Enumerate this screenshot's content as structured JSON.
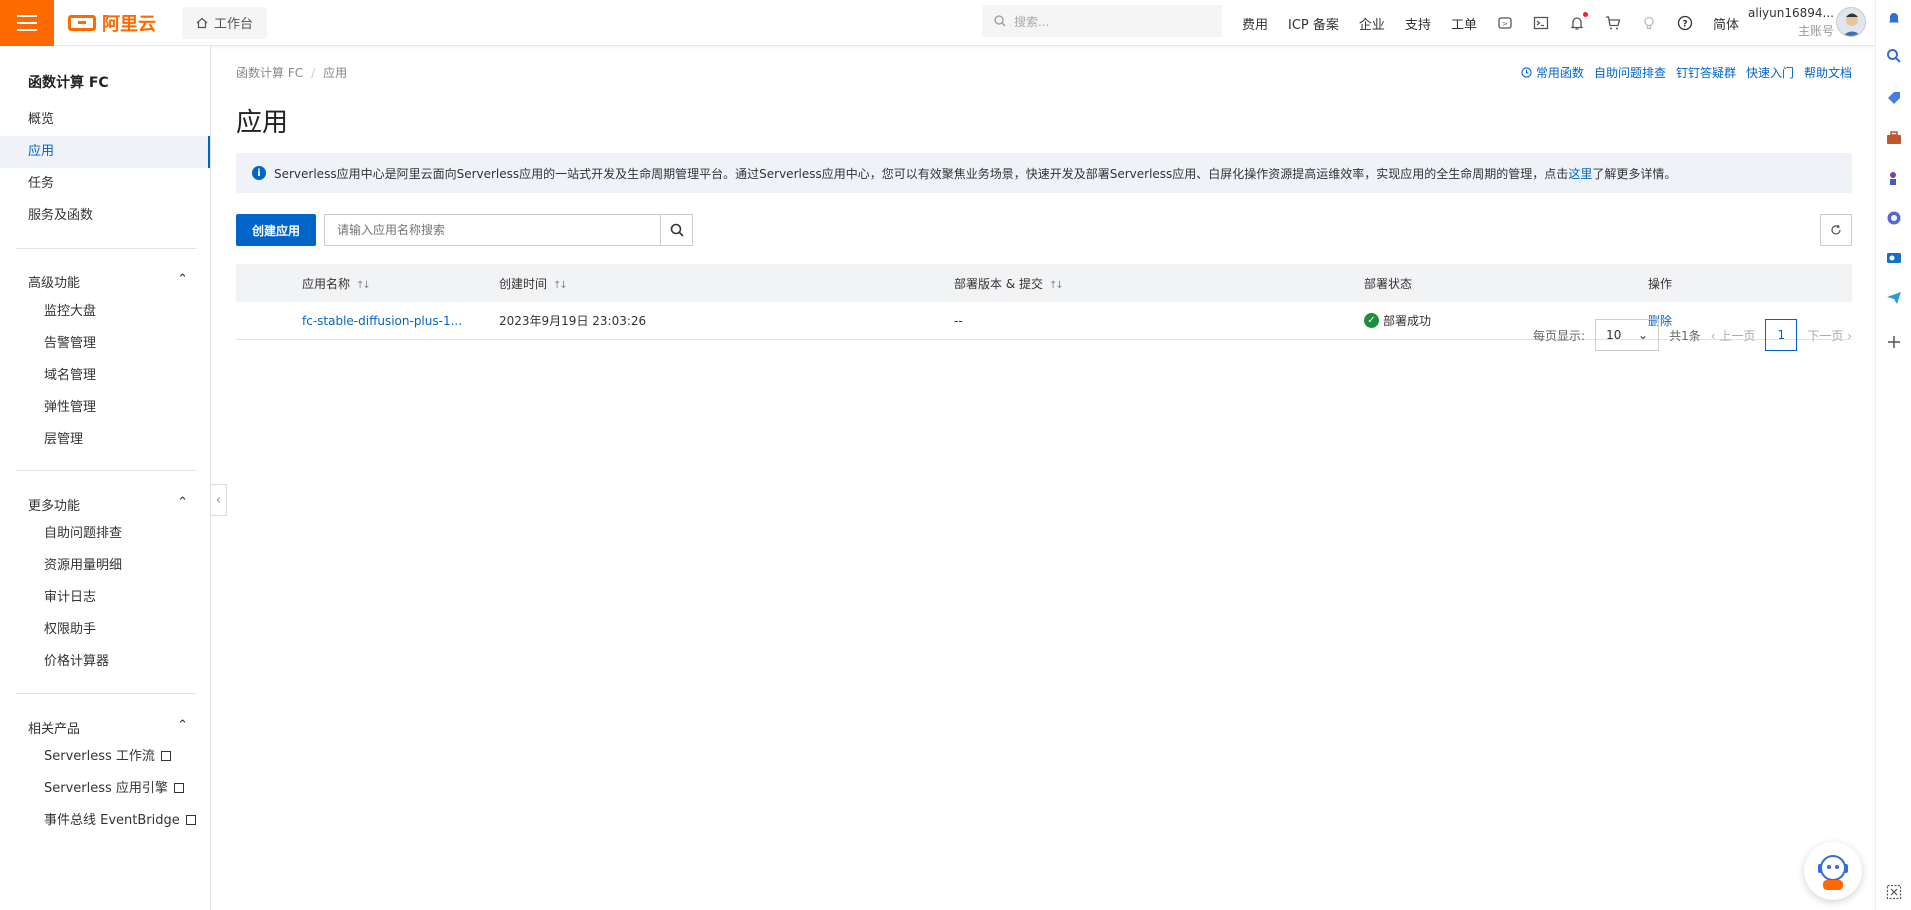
{
  "topbar": {
    "brand": "阿里云",
    "workbench_label": "工作台",
    "search_placeholder": "搜索...",
    "nav": [
      "费用",
      "ICP 备案",
      "企业",
      "支持",
      "工单"
    ],
    "lang": "简体",
    "user_name": "aliyun16894...",
    "user_sub": "主账号"
  },
  "sidebar": {
    "title": "函数计算 FC",
    "items": [
      "概览",
      "应用",
      "任务",
      "服务及函数"
    ],
    "active": "应用",
    "groups": [
      {
        "label": "高级功能",
        "items": [
          "监控大盘",
          "告警管理",
          "域名管理",
          "弹性管理",
          "层管理"
        ]
      },
      {
        "label": "更多功能",
        "items": [
          "自助问题排查",
          "资源用量明细",
          "审计日志",
          "权限助手",
          "价格计算器"
        ]
      },
      {
        "label": "相关产品",
        "items": [
          "Serverless 工作流",
          "Serverless 应用引擎",
          "事件总线 EventBridge"
        ]
      }
    ]
  },
  "main": {
    "breadcrumb": [
      "函数计算 FC",
      "应用"
    ],
    "toplinks": [
      "常用函数",
      "自助问题排查",
      "钉钉答疑群",
      "快速入门",
      "帮助文档"
    ],
    "title": "应用",
    "info_text": "Serverless应用中心是阿里云面向Serverless应用的一站式开发及生命周期管理平台。通过Serverless应用中心，您可以有效聚焦业务场景，快速开发及部署Serverless应用、白屏化操作资源提高运维效率，实现应用的全生命周期的管理，点击",
    "info_link": "这里",
    "info_tail": "了解更多详情。",
    "create_button": "创建应用",
    "search_placeholder": "请输入应用名称搜索",
    "table": {
      "headers": [
        "应用名称",
        "创建时间",
        "部署版本 & 提交",
        "部署状态",
        "操作"
      ],
      "rows": [
        {
          "name": "fc-stable-diffusion-plus-1...",
          "created": "2023年9月19日 23:03:26",
          "version": "--",
          "status": "部署成功",
          "action": "删除"
        }
      ]
    },
    "pager": {
      "per_page_label": "每页显示:",
      "per_page": "10",
      "total": "共1条",
      "prev": "上一页",
      "page": "1",
      "next": "下一页"
    }
  },
  "colors": {
    "brand": "#ff6a00",
    "primary": "#0064c8",
    "success": "#1e8e3e"
  }
}
